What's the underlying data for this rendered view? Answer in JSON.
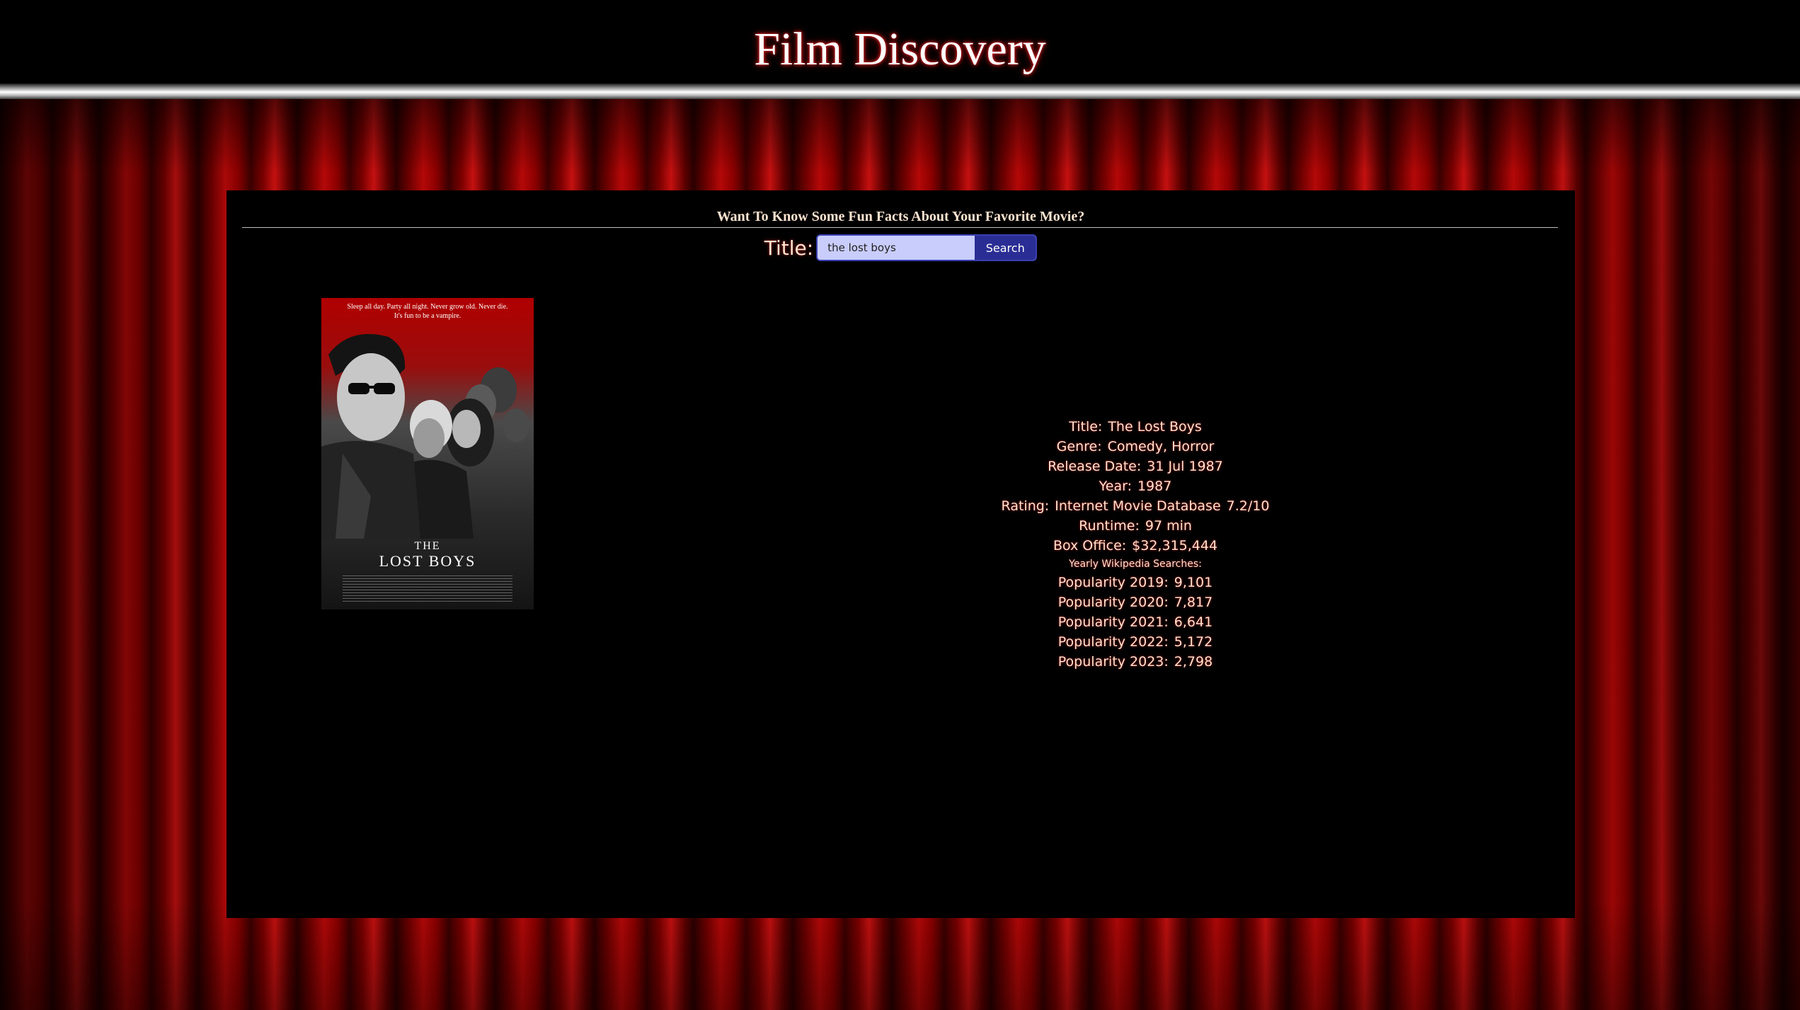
{
  "header": {
    "title": "Film Discovery"
  },
  "panel": {
    "heading": "Want To Know Some Fun Facts About Your Favorite Movie?"
  },
  "search": {
    "label": "Title:",
    "value": "the lost boys",
    "button_label": "Search"
  },
  "poster": {
    "alt": "The Lost Boys poster",
    "tagline_1": "Sleep all day. Party all night. Never grow old. Never die.",
    "tagline_2": "It's fun to be a vampire.",
    "title_the": "THE",
    "title_name": "LOST BOYS"
  },
  "movie": {
    "title_label": "Title:",
    "title_value": "The Lost Boys",
    "genre_label": "Genre:",
    "genre_value": "Comedy, Horror",
    "release_label": "Release Date:",
    "release_value": "31 Jul 1987",
    "year_label": "Year:",
    "year_value": "1987",
    "rating_label": "Rating:",
    "rating_source": "Internet Movie Database",
    "rating_value": "7.2/10",
    "runtime_label": "Runtime:",
    "runtime_value": "97 min",
    "box_office_label": "Box Office:",
    "box_office_value": "$32,315,444",
    "popularity_heading": "Yearly Wikipedia Searches:",
    "popularity": [
      {
        "label": "Popularity 2019:",
        "value": "9,101"
      },
      {
        "label": "Popularity 2020:",
        "value": "7,817"
      },
      {
        "label": "Popularity 2021:",
        "value": "6,641"
      },
      {
        "label": "Popularity 2022:",
        "value": "5,172"
      },
      {
        "label": "Popularity 2023:",
        "value": "2,798"
      }
    ]
  },
  "colors": {
    "accent_text": "#fbe3cf",
    "glow": "#b30000",
    "button": "#2a2d94",
    "input_bg": "#c9cdfb",
    "curtain": "#b40808"
  }
}
